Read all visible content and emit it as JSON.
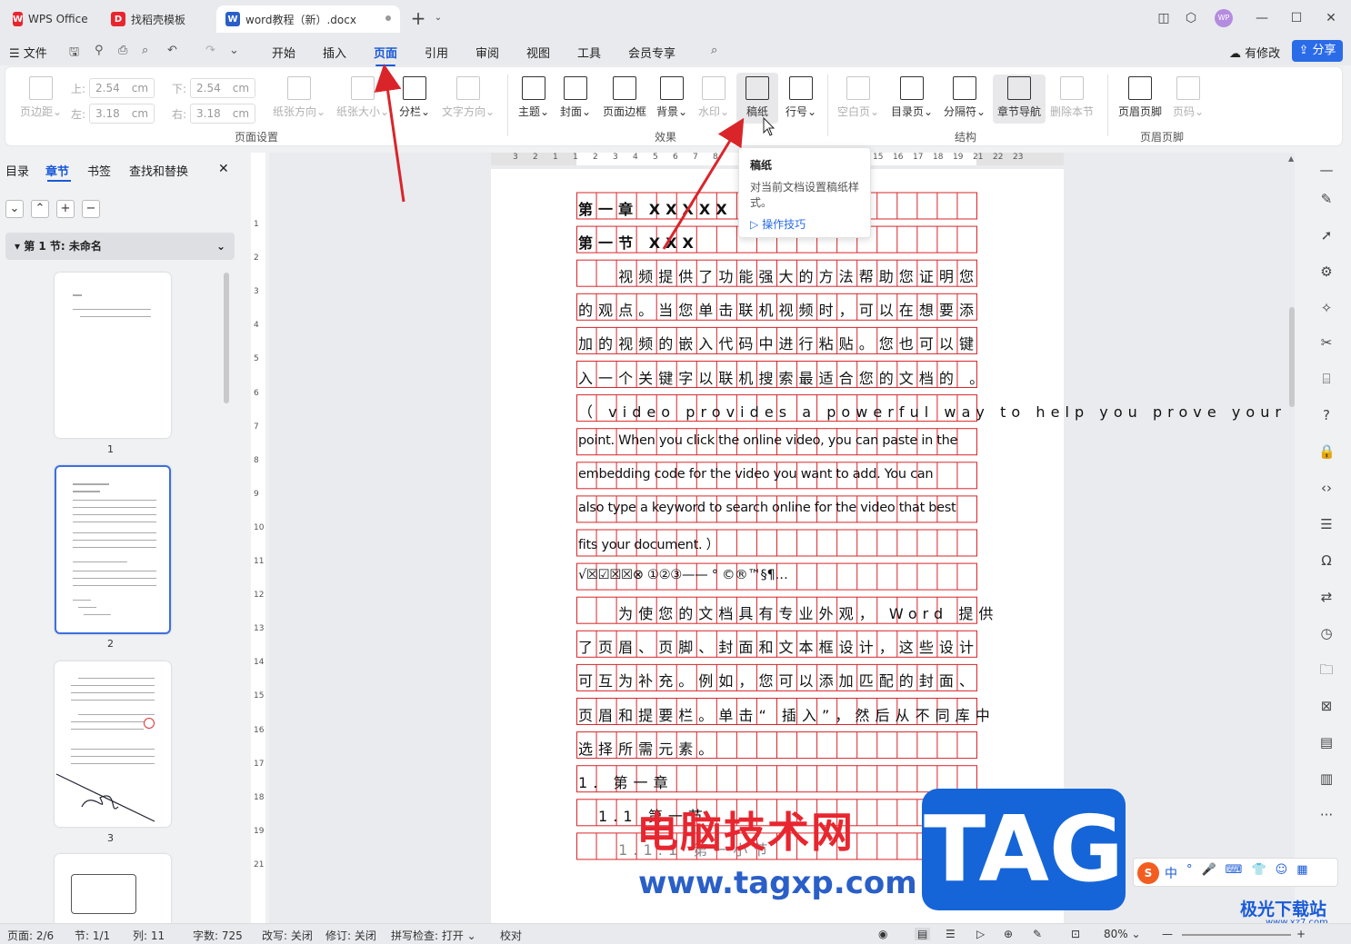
{
  "tabs": [
    {
      "label": "WPS Office",
      "icon": "wps-logo-icon",
      "color": "#e8262f"
    },
    {
      "label": "找稻壳模板",
      "icon": "docer-icon",
      "color": "#e8262f"
    },
    {
      "label": "word教程（新）.docx",
      "icon": "word-doc-icon",
      "color": "#2a5fc8"
    }
  ],
  "menu": {
    "file": "文件",
    "items": [
      "开始",
      "插入",
      "页面",
      "引用",
      "审阅",
      "视图",
      "工具",
      "会员专享"
    ],
    "active": "页面",
    "modify": "有修改",
    "share": "分享",
    "avatar": "WP"
  },
  "ribbon": {
    "margin": "页边距",
    "top_label": "上:",
    "top_val": "2.54",
    "bottom_label": "下:",
    "bottom_val": "2.54",
    "left_label": "左:",
    "left_val": "3.18",
    "right_label": "右:",
    "right_val": "3.18",
    "unit": "cm",
    "orientation": "纸张方向",
    "size": "纸张大小",
    "columns": "分栏",
    "text_dir": "文字方向",
    "group_page_setup": "页面设置",
    "theme": "主题",
    "cover": "封面",
    "border": "页面边框",
    "background": "背景",
    "watermark": "水印",
    "manuscript": "稿纸",
    "line_num": "行号",
    "group_effect": "效果",
    "blank_page": "空白页",
    "toc_page": "目录页",
    "separator": "分隔符",
    "chapter_nav": "章节导航",
    "delete_section": "删除本节",
    "group_structure": "结构",
    "header_footer": "页眉页脚",
    "page_num": "页码",
    "group_hf": "页眉页脚"
  },
  "tooltip": {
    "title": "稿纸",
    "desc_line1": "对当前文档设置稿纸样",
    "desc_line2": "式。",
    "link": "操作技巧"
  },
  "left_panel": {
    "tabs": [
      "目录",
      "章节",
      "书签",
      "查找和替换"
    ],
    "active": "章节",
    "section": "第 1 节: 未命名",
    "pages": [
      "1",
      "2",
      "3"
    ]
  },
  "ruler": {
    "h_ticks": [
      "3",
      "2",
      "1",
      "1",
      "2",
      "3",
      "4",
      "5",
      "6",
      "7",
      "8",
      "15",
      "16",
      "17",
      "18",
      "19",
      "21",
      "22",
      "23"
    ],
    "v_ticks": [
      "1",
      "2",
      "3",
      "4",
      "5",
      "6",
      "7",
      "8",
      "9",
      "10",
      "11",
      "12",
      "13",
      "14",
      "15",
      "16",
      "17",
      "18",
      "19",
      "21"
    ]
  },
  "document": {
    "rows": [
      "第一章 XXXXX",
      "第一节 XXX",
      "视频提供了功能强大的方法帮助您证明您",
      "的观点。当您单击联机视频时，可以在想要添",
      "加的视频的嵌入代码中进行粘贴。您也可以键",
      "入一个关键字以联机搜索最适合您的文档的 。",
      "（ video provides a powerful way to help you prove your",
      "point. When you click the online video, you can paste in the",
      "embedding code for the video you want to add. You can",
      "also type a keyword to search online for the video that best",
      "fits your document. ）",
      "√☒☑☒☒⊗ ①②③—— ° ©®™§¶…",
      "为使您的文档具有专业外观， Word 提供",
      "了页眉、页脚、封面和文本框设计，这些设计",
      "可互为补充。例如，您可以添加匹配的封面、",
      "页眉和提要栏。单击“ 插入”，然后从不同库中",
      "选择所需元素。",
      "1. 第一章",
      "1.1 第一节",
      "1.1.1 第一小节"
    ]
  },
  "status": {
    "page": "页面: 2/6",
    "section": "节: 1/1",
    "col": "列: 11",
    "words": "字数: 725",
    "revise": "改写: 关闭",
    "track": "修订: 关闭",
    "spell": "拼写检查: 打开",
    "proof": "校对",
    "zoom": "80%"
  },
  "watermark": {
    "cn": "电脑技术网",
    "url": "www.tagxp.com",
    "tag": "TAG",
    "site": "极光下载站",
    "site_url": "www.xz7.com"
  },
  "ime": {
    "lang": "中"
  },
  "colors": {
    "accent": "#1a5ad8",
    "grid_red": "#d9252a",
    "arrow_red": "#d9252a",
    "page_bg": "#ffffff"
  }
}
